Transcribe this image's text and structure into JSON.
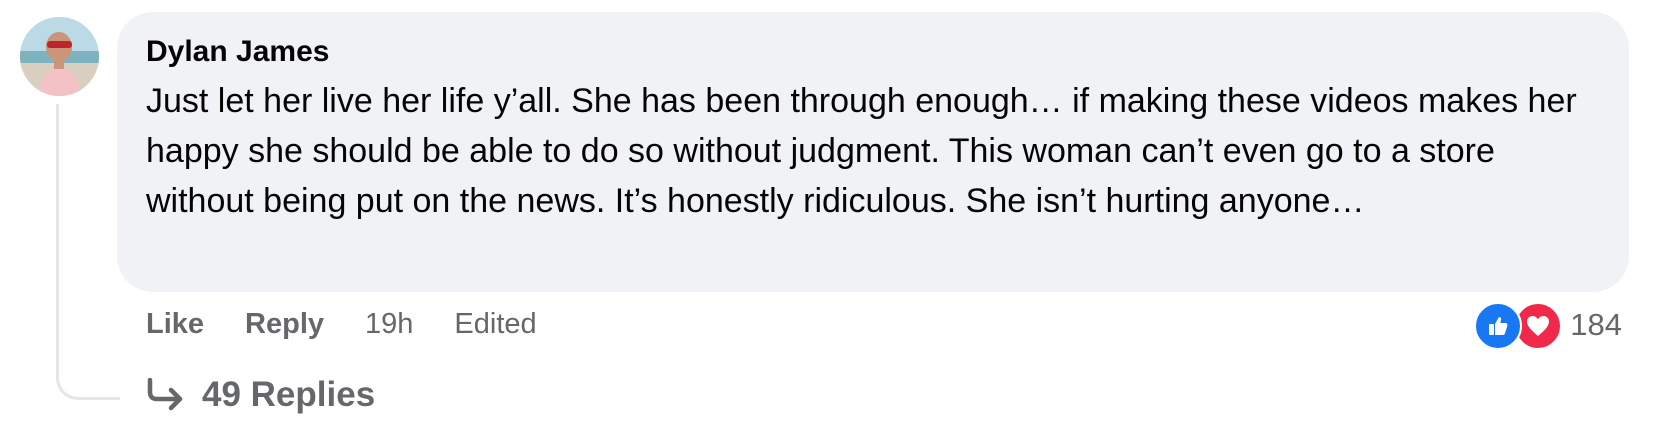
{
  "comment": {
    "author": "Dylan James",
    "text": "Just let her live her life y’all. She has been through enough… if making these videos makes her happy she should be able to do so without judgment. This woman can’t even go to a store without being put on the news. It’s honestly ridiculous. She isn’t hurting anyone…",
    "avatar_icon": "profile-photo"
  },
  "actions": {
    "like_label": "Like",
    "reply_label": "Reply",
    "time": "19h",
    "edited": "Edited"
  },
  "reactions": {
    "icons": [
      "like-reaction-icon",
      "love-reaction-icon"
    ],
    "count": "184",
    "like_color": "#1877f2",
    "love_color": "#f02849"
  },
  "replies": {
    "label": "49 Replies",
    "icon": "reply-arrow-icon"
  },
  "colors": {
    "bubble_bg": "#f0f2f5",
    "secondary_text": "#65676b",
    "thread_line": "#e4e6eb"
  }
}
